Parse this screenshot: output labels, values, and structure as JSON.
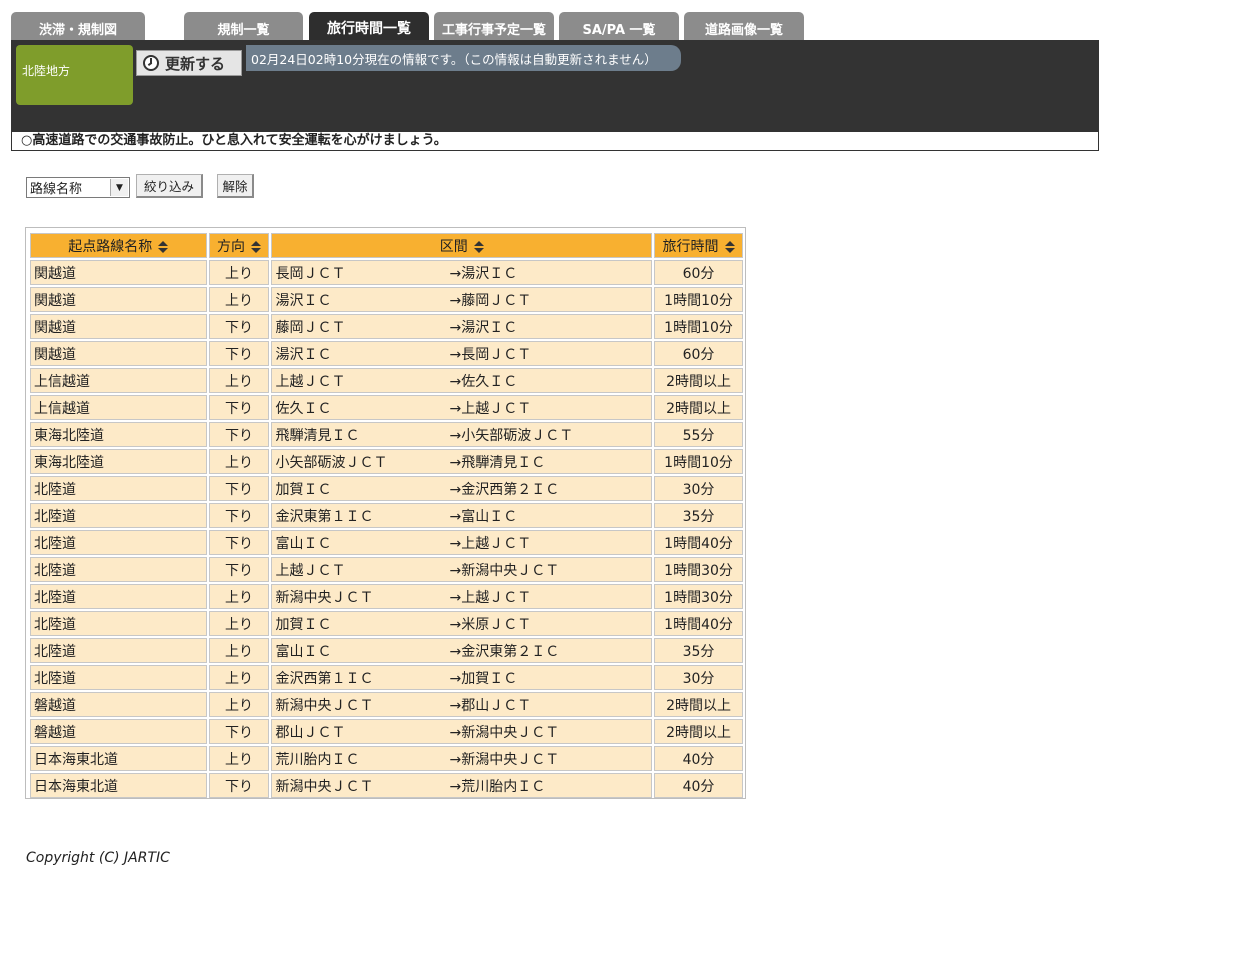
{
  "tabs": [
    {
      "label": "渋滞・規制図"
    },
    {
      "label": "規制一覧"
    },
    {
      "label": "旅行時間一覧"
    },
    {
      "label": "工事行事予定一覧"
    },
    {
      "label": "SA/PA 一覧"
    },
    {
      "label": "道路画像一覧"
    }
  ],
  "header": {
    "region": "北陸地方",
    "refresh_label": "更新する",
    "status": "02月24日02時10分現在の情報です。（この情報は自動更新されません）",
    "notice": "○高速道路での交通事故防止。ひと息入れて安全運転を心がけましょう。"
  },
  "filter": {
    "select_value": "路線名称",
    "filter_button": "絞り込み",
    "clear_button": "解除"
  },
  "table": {
    "headers": {
      "route": "起点路線名称",
      "direction": "方向",
      "section": "区間",
      "time": "旅行時間"
    },
    "rows": [
      {
        "route": "関越道",
        "dir": "上り",
        "from": "長岡ＪＣＴ",
        "to": "→湯沢ＩＣ",
        "time": "60分"
      },
      {
        "route": "関越道",
        "dir": "上り",
        "from": "湯沢ＩＣ",
        "to": "→藤岡ＪＣＴ",
        "time": "1時間10分"
      },
      {
        "route": "関越道",
        "dir": "下り",
        "from": "藤岡ＪＣＴ",
        "to": "→湯沢ＩＣ",
        "time": "1時間10分"
      },
      {
        "route": "関越道",
        "dir": "下り",
        "from": "湯沢ＩＣ",
        "to": "→長岡ＪＣＴ",
        "time": "60分"
      },
      {
        "route": "上信越道",
        "dir": "上り",
        "from": "上越ＪＣＴ",
        "to": "→佐久ＩＣ",
        "time": "2時間以上"
      },
      {
        "route": "上信越道",
        "dir": "下り",
        "from": "佐久ＩＣ",
        "to": "→上越ＪＣＴ",
        "time": "2時間以上"
      },
      {
        "route": "東海北陸道",
        "dir": "下り",
        "from": "飛騨清見ＩＣ",
        "to": "→小矢部砺波ＪＣＴ",
        "time": "55分"
      },
      {
        "route": "東海北陸道",
        "dir": "上り",
        "from": "小矢部砺波ＪＣＴ",
        "to": "→飛騨清見ＩＣ",
        "time": "1時間10分"
      },
      {
        "route": "北陸道",
        "dir": "下り",
        "from": "加賀ＩＣ",
        "to": "→金沢西第２ＩＣ",
        "time": "30分"
      },
      {
        "route": "北陸道",
        "dir": "下り",
        "from": "金沢東第１ＩＣ",
        "to": "→富山ＩＣ",
        "time": "35分"
      },
      {
        "route": "北陸道",
        "dir": "下り",
        "from": "富山ＩＣ",
        "to": "→上越ＪＣＴ",
        "time": "1時間40分"
      },
      {
        "route": "北陸道",
        "dir": "下り",
        "from": "上越ＪＣＴ",
        "to": "→新潟中央ＪＣＴ",
        "time": "1時間30分"
      },
      {
        "route": "北陸道",
        "dir": "上り",
        "from": "新潟中央ＪＣＴ",
        "to": "→上越ＪＣＴ",
        "time": "1時間30分"
      },
      {
        "route": "北陸道",
        "dir": "上り",
        "from": "加賀ＩＣ",
        "to": "→米原ＪＣＴ",
        "time": "1時間40分"
      },
      {
        "route": "北陸道",
        "dir": "上り",
        "from": "富山ＩＣ",
        "to": "→金沢東第２ＩＣ",
        "time": "35分"
      },
      {
        "route": "北陸道",
        "dir": "上り",
        "from": "金沢西第１ＩＣ",
        "to": "→加賀ＩＣ",
        "time": "30分"
      },
      {
        "route": "磐越道",
        "dir": "上り",
        "from": "新潟中央ＪＣＴ",
        "to": "→郡山ＪＣＴ",
        "time": "2時間以上"
      },
      {
        "route": "磐越道",
        "dir": "下り",
        "from": "郡山ＪＣＴ",
        "to": "→新潟中央ＪＣＴ",
        "time": "2時間以上"
      },
      {
        "route": "日本海東北道",
        "dir": "上り",
        "from": "荒川胎内ＩＣ",
        "to": "→新潟中央ＪＣＴ",
        "time": "40分"
      },
      {
        "route": "日本海東北道",
        "dir": "下り",
        "from": "新潟中央ＪＣＴ",
        "to": "→荒川胎内ＩＣ",
        "time": "40分"
      }
    ]
  },
  "footer": {
    "copyright": "Copyright (C) JARTIC"
  },
  "colors": {
    "tab_bg": "#8c8c8c",
    "tab_active_bg": "#2e2e2e",
    "header_bg": "#333333",
    "region_bg": "#7f9d2b",
    "status_bg": "#6d7d8c",
    "th_bg": "#f8b030",
    "td_bg": "#fdeac8"
  }
}
